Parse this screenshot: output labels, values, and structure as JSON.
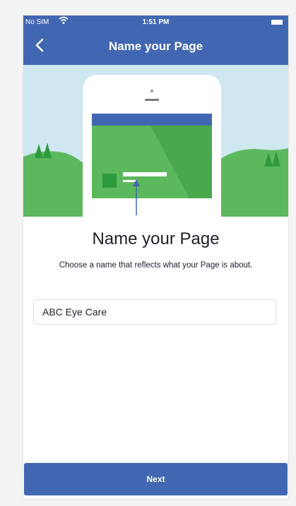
{
  "status_bar": {
    "carrier": "No SIM",
    "time": "1:51 PM",
    "icons": [
      "wifi-icon",
      "battery-icon"
    ]
  },
  "nav": {
    "back_icon": "chevron-left-icon",
    "title": "Name your Page"
  },
  "illustration": {
    "description_icons": [
      "phone-icon",
      "tree-icon",
      "hill-icon",
      "arrow-up-icon"
    ]
  },
  "content": {
    "title": "Name your Page",
    "subtitle": "Choose a name that reflects what your Page is about."
  },
  "page_name_field": {
    "value": "ABC Eye Care"
  },
  "next_button": {
    "label": "Next"
  },
  "colors": {
    "brand_blue": "#4267b2",
    "sky": "#cfe7f0",
    "grass": "#5cb85c",
    "tree": "#2e9a3e"
  }
}
